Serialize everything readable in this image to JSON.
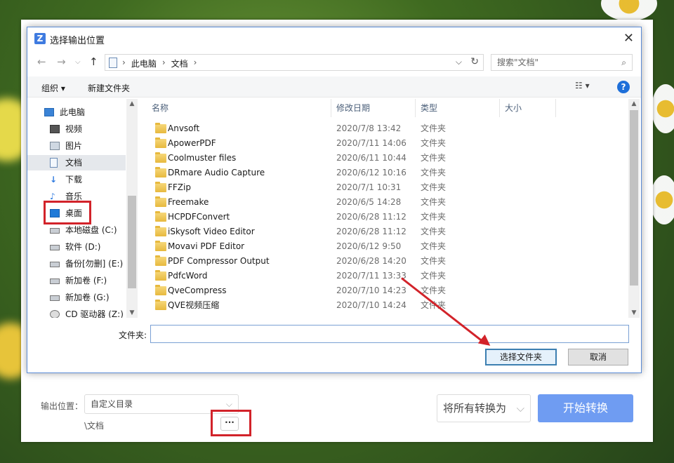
{
  "dialog": {
    "title": "选择输出位置",
    "address": [
      "此电脑",
      "文档"
    ],
    "search_placeholder": "搜索\"文档\"",
    "toolbar": {
      "organize": "组织",
      "new_folder": "新建文件夹"
    },
    "sidebar": [
      {
        "label": "此电脑",
        "icon": "computer-icon",
        "level": "top"
      },
      {
        "label": "视频",
        "icon": "video-folder-icon"
      },
      {
        "label": "图片",
        "icon": "pictures-folder-icon"
      },
      {
        "label": "文档",
        "icon": "documents-folder-icon",
        "selected": true
      },
      {
        "label": "下载",
        "icon": "download-icon"
      },
      {
        "label": "音乐",
        "icon": "music-icon"
      },
      {
        "label": "桌面",
        "icon": "desktop-icon",
        "highlighted": true
      },
      {
        "label": "本地磁盘 (C:)",
        "icon": "drive-icon"
      },
      {
        "label": "软件 (D:)",
        "icon": "drive-icon"
      },
      {
        "label": "备份[勿删] (E:)",
        "icon": "drive-icon"
      },
      {
        "label": "新加卷 (F:)",
        "icon": "drive-icon"
      },
      {
        "label": "新加卷 (G:)",
        "icon": "drive-icon"
      },
      {
        "label": "CD 驱动器 (Z:)",
        "icon": "cd-drive-icon"
      }
    ],
    "columns": {
      "name": "名称",
      "date": "修改日期",
      "type": "类型",
      "size": "大小"
    },
    "files": [
      {
        "name": "Anvsoft",
        "date": "2020/7/8 13:42",
        "type": "文件夹"
      },
      {
        "name": "ApowerPDF",
        "date": "2020/7/11 14:06",
        "type": "文件夹"
      },
      {
        "name": "Coolmuster files",
        "date": "2020/6/11 10:44",
        "type": "文件夹"
      },
      {
        "name": "DRmare Audio Capture",
        "date": "2020/6/12 10:16",
        "type": "文件夹"
      },
      {
        "name": "FFZip",
        "date": "2020/7/1 10:31",
        "type": "文件夹"
      },
      {
        "name": "Freemake",
        "date": "2020/6/5 14:28",
        "type": "文件夹"
      },
      {
        "name": "HCPDFConvert",
        "date": "2020/6/28 11:12",
        "type": "文件夹"
      },
      {
        "name": "iSkysoft Video Editor",
        "date": "2020/6/28 11:12",
        "type": "文件夹"
      },
      {
        "name": "Movavi PDF Editor",
        "date": "2020/6/12 9:50",
        "type": "文件夹"
      },
      {
        "name": "PDF Compressor Output",
        "date": "2020/6/28 14:20",
        "type": "文件夹"
      },
      {
        "name": "PdfcWord",
        "date": "2020/7/11 13:33",
        "type": "文件夹"
      },
      {
        "name": "QveCompress",
        "date": "2020/7/10 14:23",
        "type": "文件夹"
      },
      {
        "name": "QVE视频压缩",
        "date": "2020/7/10 14:24",
        "type": "文件夹"
      }
    ],
    "folder_label": "文件夹:",
    "folder_value": "",
    "select_button": "选择文件夹",
    "cancel_button": "取消"
  },
  "app": {
    "output_label": "输出位置：",
    "output_select": "自定义目录",
    "output_path": "\\文档",
    "browse_button": "···",
    "convert_all": "将所有转换为",
    "start_button": "开始转换"
  },
  "colors": {
    "accent": "#6f9cf2",
    "highlight": "#d2232a",
    "selection": "#e5e8ec"
  }
}
